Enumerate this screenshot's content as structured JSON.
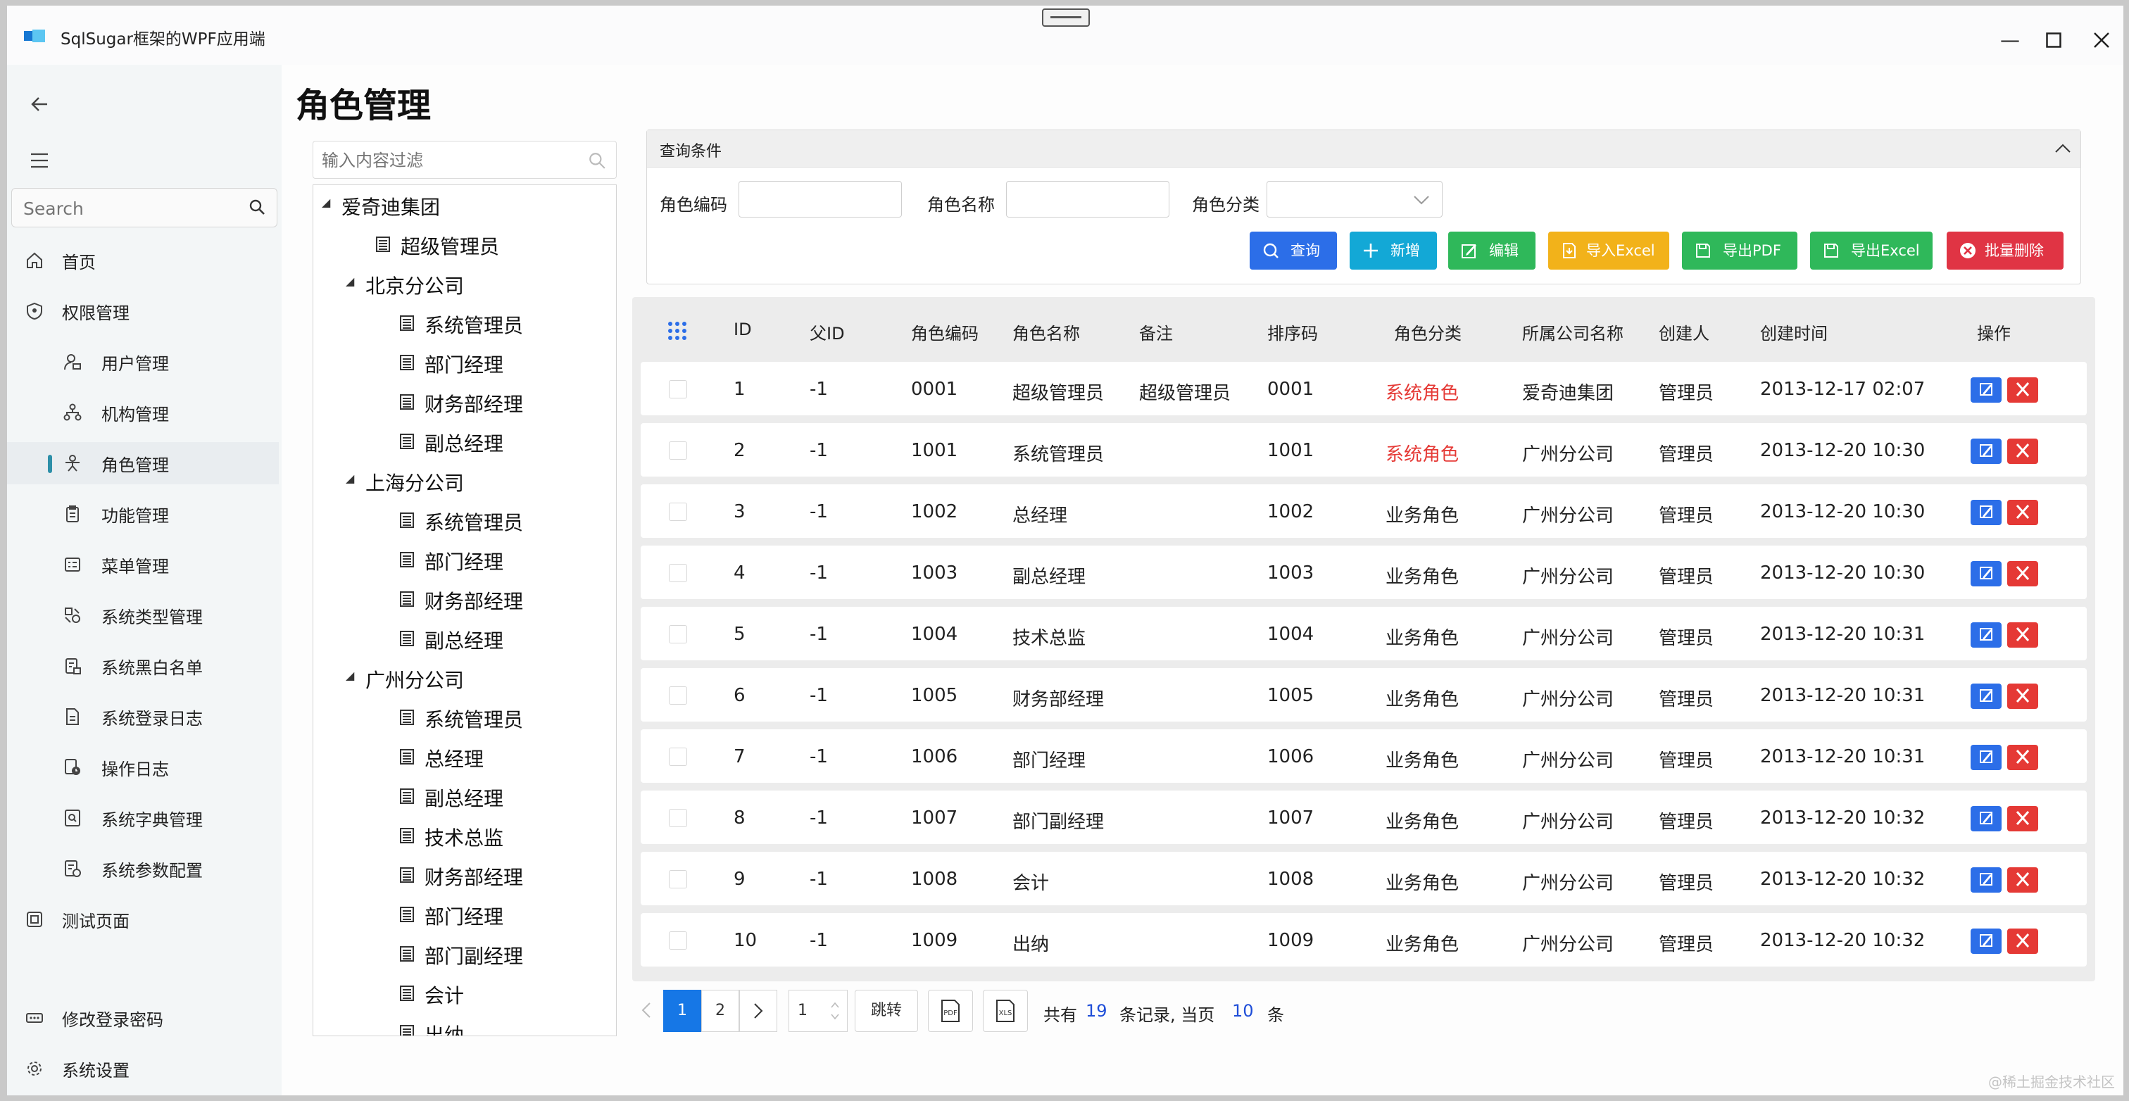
{
  "window": {
    "title": "SqlSugar框架的WPF应用端",
    "minimize": "—",
    "maximize": "▢",
    "close": "✕"
  },
  "nav": {
    "search_placeholder": "Search",
    "items": [
      {
        "label": "首页",
        "icon": "home-icon"
      },
      {
        "label": "权限管理",
        "icon": "shield-icon"
      },
      {
        "label": "用户管理",
        "icon": "user-icon"
      },
      {
        "label": "机构管理",
        "icon": "org-icon"
      },
      {
        "label": "角色管理",
        "icon": "role-icon",
        "active": true
      },
      {
        "label": "功能管理",
        "icon": "clipboard-icon"
      },
      {
        "label": "菜单管理",
        "icon": "menu-grid-icon"
      },
      {
        "label": "系统类型管理",
        "icon": "type-icon"
      },
      {
        "label": "系统黑白名单",
        "icon": "list-lock-icon"
      },
      {
        "label": "系统登录日志",
        "icon": "document-icon"
      },
      {
        "label": "操作日志",
        "icon": "log-clock-icon"
      },
      {
        "label": "系统字典管理",
        "icon": "dictionary-icon"
      },
      {
        "label": "系统参数配置",
        "icon": "config-icon"
      },
      {
        "label": "测试页面",
        "icon": "test-icon"
      }
    ],
    "footer": [
      {
        "label": "修改登录密码",
        "icon": "password-icon"
      },
      {
        "label": "系统设置",
        "icon": "gear-icon"
      }
    ]
  },
  "page": {
    "title": "角色管理"
  },
  "tree": {
    "filter_placeholder": "输入内容过滤",
    "nodes": [
      {
        "label": "爱奇迪集团",
        "level": 0,
        "expander": true
      },
      {
        "label": "超级管理员",
        "level": 1
      },
      {
        "label": "北京分公司",
        "level": 1,
        "expander": true
      },
      {
        "label": "系统管理员",
        "level": 2
      },
      {
        "label": "部门经理",
        "level": 2
      },
      {
        "label": "财务部经理",
        "level": 2
      },
      {
        "label": "副总经理",
        "level": 2
      },
      {
        "label": "上海分公司",
        "level": 1,
        "expander": true
      },
      {
        "label": "系统管理员",
        "level": 2
      },
      {
        "label": "部门经理",
        "level": 2
      },
      {
        "label": "财务部经理",
        "level": 2
      },
      {
        "label": "副总经理",
        "level": 2
      },
      {
        "label": "广州分公司",
        "level": 1,
        "expander": true
      },
      {
        "label": "系统管理员",
        "level": 2
      },
      {
        "label": "总经理",
        "level": 2
      },
      {
        "label": "副总经理",
        "level": 2
      },
      {
        "label": "技术总监",
        "level": 2
      },
      {
        "label": "财务部经理",
        "level": 2
      },
      {
        "label": "部门经理",
        "level": 2
      },
      {
        "label": "部门副经理",
        "level": 2
      },
      {
        "label": "会计",
        "level": 2
      },
      {
        "label": "出纳",
        "level": 2
      }
    ]
  },
  "query": {
    "header": "查询条件",
    "fields": {
      "code_label": "角色编码",
      "name_label": "角色名称",
      "category_label": "角色分类",
      "code_value": "",
      "name_value": "",
      "category_value": ""
    },
    "buttons": {
      "search": "查询",
      "add": "新增",
      "edit": "编辑",
      "import_excel": "导入Excel",
      "export_pdf": "导出PDF",
      "export_excel": "导出Excel",
      "batch_delete": "批量删除"
    }
  },
  "colors": {
    "search": "#2c6ee8",
    "add": "#13a8d6",
    "edit": "#2fb85a",
    "import": "#f2b21a",
    "export": "#2fb85a",
    "delete": "#e03444",
    "red_text": "#e53935"
  },
  "grid": {
    "columns": [
      "ID",
      "父ID",
      "角色编码",
      "角色名称",
      "备注",
      "排序码",
      "角色分类",
      "所属公司名称",
      "创建人",
      "创建时间",
      "操作"
    ],
    "rows": [
      {
        "id": "1",
        "pid": "-1",
        "code": "0001",
        "name": "超级管理员",
        "note": "超级管理员",
        "sort": "0001",
        "category": "系统角色",
        "company": "爱奇迪集团",
        "creator": "管理员",
        "time": "2013-12-17 02:07"
      },
      {
        "id": "2",
        "pid": "-1",
        "code": "1001",
        "name": "系统管理员",
        "note": "",
        "sort": "1001",
        "category": "系统角色",
        "company": "广州分公司",
        "creator": "管理员",
        "time": "2013-12-20 10:30"
      },
      {
        "id": "3",
        "pid": "-1",
        "code": "1002",
        "name": "总经理",
        "note": "",
        "sort": "1002",
        "category": "业务角色",
        "company": "广州分公司",
        "creator": "管理员",
        "time": "2013-12-20 10:30"
      },
      {
        "id": "4",
        "pid": "-1",
        "code": "1003",
        "name": "副总经理",
        "note": "",
        "sort": "1003",
        "category": "业务角色",
        "company": "广州分公司",
        "creator": "管理员",
        "time": "2013-12-20 10:30"
      },
      {
        "id": "5",
        "pid": "-1",
        "code": "1004",
        "name": "技术总监",
        "note": "",
        "sort": "1004",
        "category": "业务角色",
        "company": "广州分公司",
        "creator": "管理员",
        "time": "2013-12-20 10:31"
      },
      {
        "id": "6",
        "pid": "-1",
        "code": "1005",
        "name": "财务部经理",
        "note": "",
        "sort": "1005",
        "category": "业务角色",
        "company": "广州分公司",
        "creator": "管理员",
        "time": "2013-12-20 10:31"
      },
      {
        "id": "7",
        "pid": "-1",
        "code": "1006",
        "name": "部门经理",
        "note": "",
        "sort": "1006",
        "category": "业务角色",
        "company": "广州分公司",
        "creator": "管理员",
        "time": "2013-12-20 10:31"
      },
      {
        "id": "8",
        "pid": "-1",
        "code": "1007",
        "name": "部门副经理",
        "note": "",
        "sort": "1007",
        "category": "业务角色",
        "company": "广州分公司",
        "creator": "管理员",
        "time": "2013-12-20 10:32"
      },
      {
        "id": "9",
        "pid": "-1",
        "code": "1008",
        "name": "会计",
        "note": "",
        "sort": "1008",
        "category": "业务角色",
        "company": "广州分公司",
        "creator": "管理员",
        "time": "2013-12-20 10:32"
      },
      {
        "id": "10",
        "pid": "-1",
        "code": "1009",
        "name": "出纳",
        "note": "",
        "sort": "1009",
        "category": "业务角色",
        "company": "广州分公司",
        "creator": "管理员",
        "time": "2013-12-20 10:32"
      }
    ]
  },
  "pager": {
    "pages": [
      "1",
      "2"
    ],
    "current": "1",
    "jump_value": "1",
    "jump_label": "跳转",
    "pdf_label": "PDF",
    "xls_label": "XLS",
    "total_prefix": "共有",
    "total": "19",
    "middle": "条记录, 当页",
    "page_size": "10",
    "suffix": "条"
  },
  "watermark": "@稀土掘金技术社区"
}
